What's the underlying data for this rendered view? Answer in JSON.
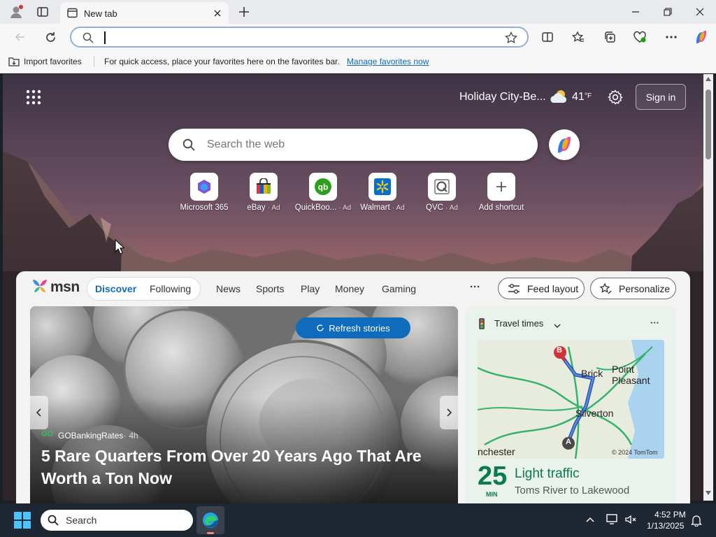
{
  "browser": {
    "tab_title": "New tab",
    "address_value": "",
    "favorites_bar": {
      "import_label": "Import favorites",
      "message": "For quick access, place your favorites here on the favorites bar.",
      "manage_link": "Manage favorites now"
    }
  },
  "newtab": {
    "location": "Holiday City-Be...",
    "temperature": "41",
    "temp_unit": "°F",
    "sign_in": "Sign in",
    "search_placeholder": "Search the web",
    "shortcuts": [
      {
        "label": "Microsoft 365",
        "ad": ""
      },
      {
        "label": "eBay",
        "ad": "· Ad"
      },
      {
        "label": "QuickBoo...",
        "ad": "· Ad"
      },
      {
        "label": "Walmart",
        "ad": "· Ad"
      },
      {
        "label": "QVC",
        "ad": "· Ad"
      },
      {
        "label": "Add shortcut",
        "ad": ""
      }
    ]
  },
  "msn": {
    "logo": "msn",
    "tabs": {
      "discover": "Discover",
      "following": "Following"
    },
    "nav": [
      "News",
      "Sports",
      "Play",
      "Money",
      "Gaming"
    ],
    "more": "···",
    "feed_layout": "Feed layout",
    "personalize": "Personalize",
    "hero": {
      "refresh": "Refresh stories",
      "source_badge": "GO",
      "source": "GOBankingRates",
      "age": "· 4h",
      "headline": "5 Rare Quarters From Over 20 Years Ago That Are Worth a Ton Now"
    },
    "travel": {
      "title": "Travel times",
      "more": "···",
      "map_labels": {
        "brick": "Brick",
        "point_pleasant": "Point Pleasant",
        "silverton": "Silverton",
        "manchester": "nchester",
        "copyright": "© 2024 TomTom",
        "start": "A",
        "end": "B"
      },
      "minutes": "25",
      "min_label": "MIN",
      "traffic": "Light traffic",
      "route": "Toms River to Lakewood"
    }
  },
  "taskbar": {
    "search_placeholder": "Search",
    "time": "4:52 PM",
    "date": "1/13/2025"
  },
  "colors": {
    "accent": "#0f6cbd",
    "msn_blue": "#0f6cbd",
    "traffic_green": "#0a7a4f",
    "taskbar": "#1f2733"
  }
}
